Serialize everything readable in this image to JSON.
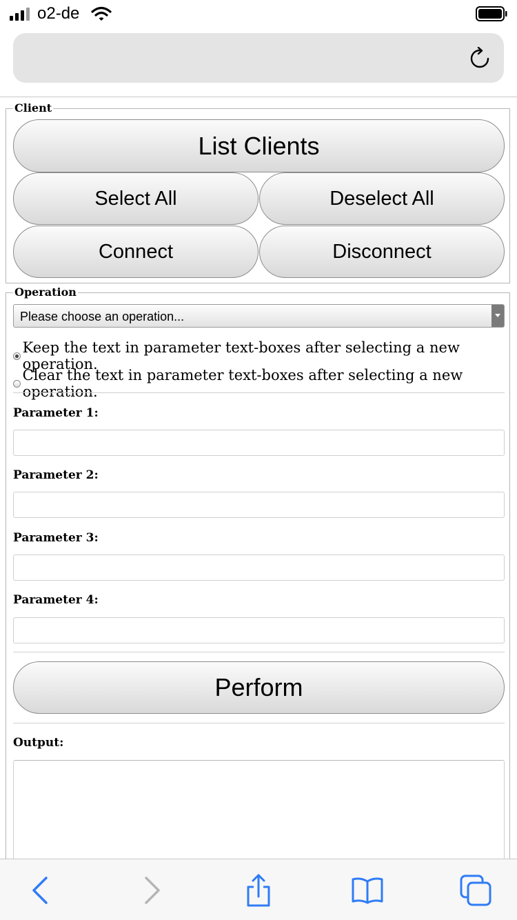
{
  "status": {
    "carrier": "o2-de"
  },
  "client": {
    "legend": "Client",
    "list_clients": "List Clients",
    "select_all": "Select All",
    "deselect_all": "Deselect All",
    "connect": "Connect",
    "disconnect": "Disconnect"
  },
  "operation": {
    "legend": "Operation",
    "select_value": "Please choose an operation...",
    "radio_keep": "Keep the text in parameter text-boxes after selecting a new operation.",
    "radio_clear": "Clear the text in parameter text-boxes after selecting a new operation.",
    "radio_selected": "keep",
    "params": [
      {
        "label": "Parameter 1:",
        "value": ""
      },
      {
        "label": "Parameter 2:",
        "value": ""
      },
      {
        "label": "Parameter 3:",
        "value": ""
      },
      {
        "label": "Parameter 4:",
        "value": ""
      }
    ],
    "perform": "Perform",
    "output_label": "Output:",
    "output_value": ""
  },
  "icons": {
    "reload": "reload-icon",
    "back": "chevron-left-icon",
    "forward": "chevron-right-icon",
    "share": "share-icon",
    "bookmarks": "book-icon",
    "tabs": "tabs-icon"
  },
  "colors": {
    "toolbar_accent": "#2f7cf6",
    "toolbar_disabled": "#b5b5b5"
  }
}
